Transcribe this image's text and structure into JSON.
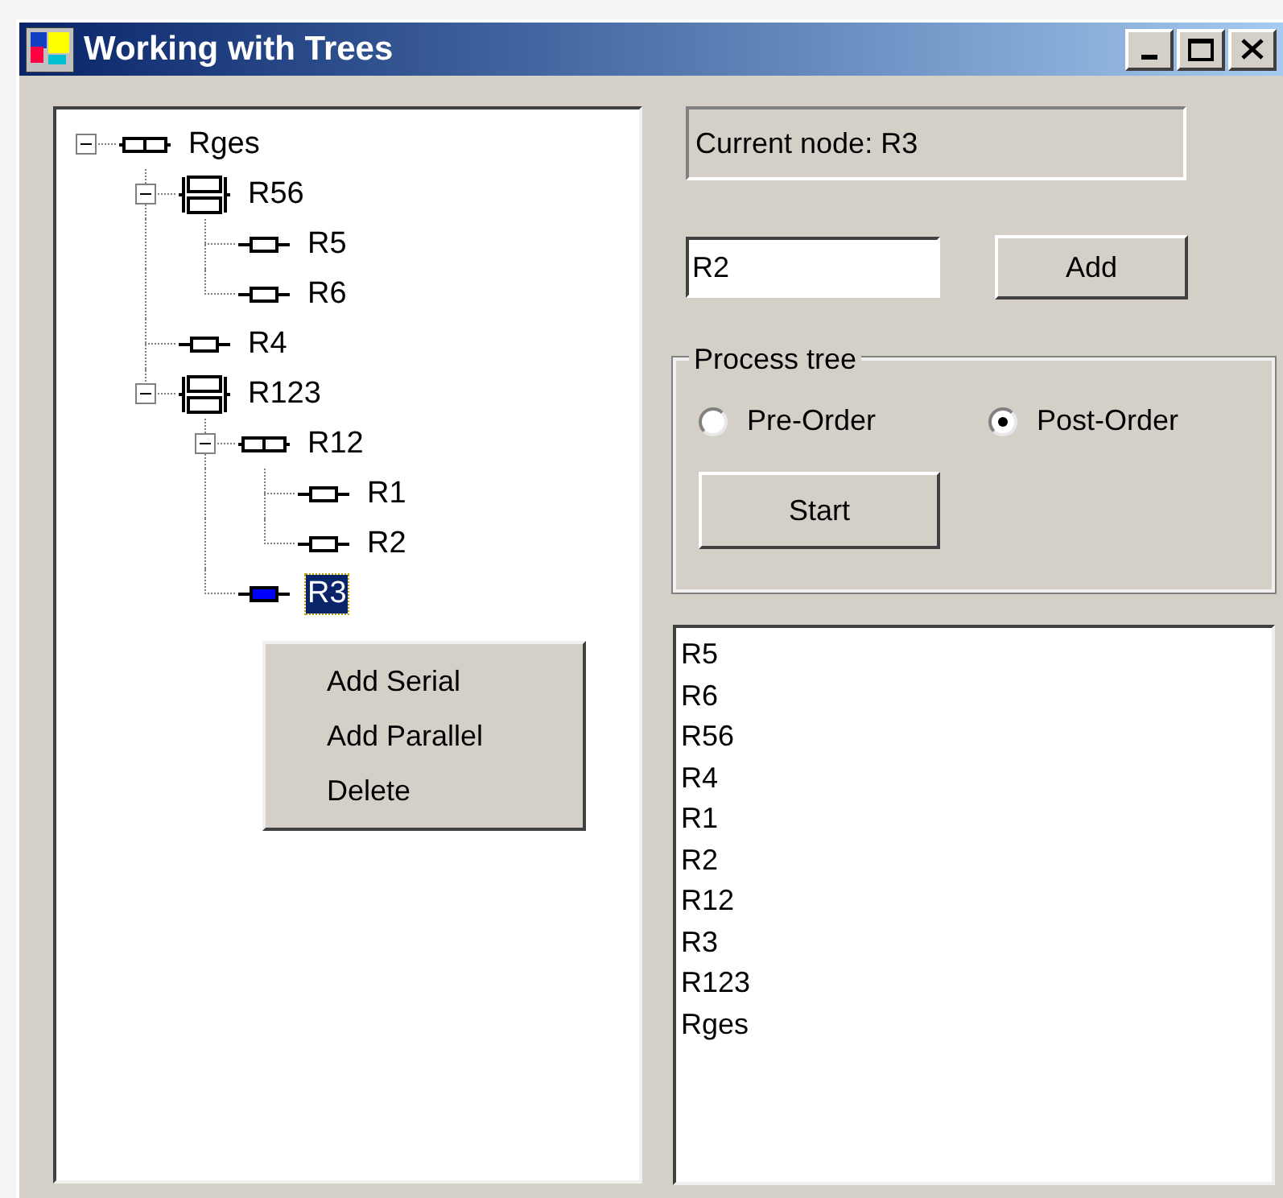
{
  "window": {
    "title": "Working with Trees"
  },
  "tree": {
    "nodes": [
      {
        "label": "Rges",
        "kind": "serial",
        "expanded": true,
        "selected": false,
        "children": [
          {
            "label": "R56",
            "kind": "parallel",
            "expanded": true,
            "selected": false,
            "children": [
              {
                "label": "R5",
                "kind": "resistor",
                "selected": false
              },
              {
                "label": "R6",
                "kind": "resistor",
                "selected": false
              }
            ]
          },
          {
            "label": "R4",
            "kind": "resistor",
            "selected": false
          },
          {
            "label": "R123",
            "kind": "parallel",
            "expanded": true,
            "selected": false,
            "children": [
              {
                "label": "R12",
                "kind": "serial",
                "expanded": true,
                "selected": false,
                "children": [
                  {
                    "label": "R1",
                    "kind": "resistor",
                    "selected": false
                  },
                  {
                    "label": "R2",
                    "kind": "resistor",
                    "selected": false
                  }
                ]
              },
              {
                "label": "R3",
                "kind": "resistor",
                "selected": true
              }
            ]
          }
        ]
      }
    ]
  },
  "context_menu": {
    "items": [
      "Add Serial",
      "Add Parallel",
      "Delete"
    ]
  },
  "current_node": "Current node: R3",
  "name_field": {
    "value": "R2"
  },
  "add_button": "Add",
  "process_group": {
    "title": "Process tree",
    "options": [
      {
        "label": "Pre-Order",
        "selected": false
      },
      {
        "label": "Post-Order",
        "selected": true
      }
    ],
    "start_button": "Start"
  },
  "output_list": [
    "R5",
    "R6",
    "R56",
    "R4",
    "R1",
    "R2",
    "R12",
    "R3",
    "R123",
    "Rges"
  ]
}
